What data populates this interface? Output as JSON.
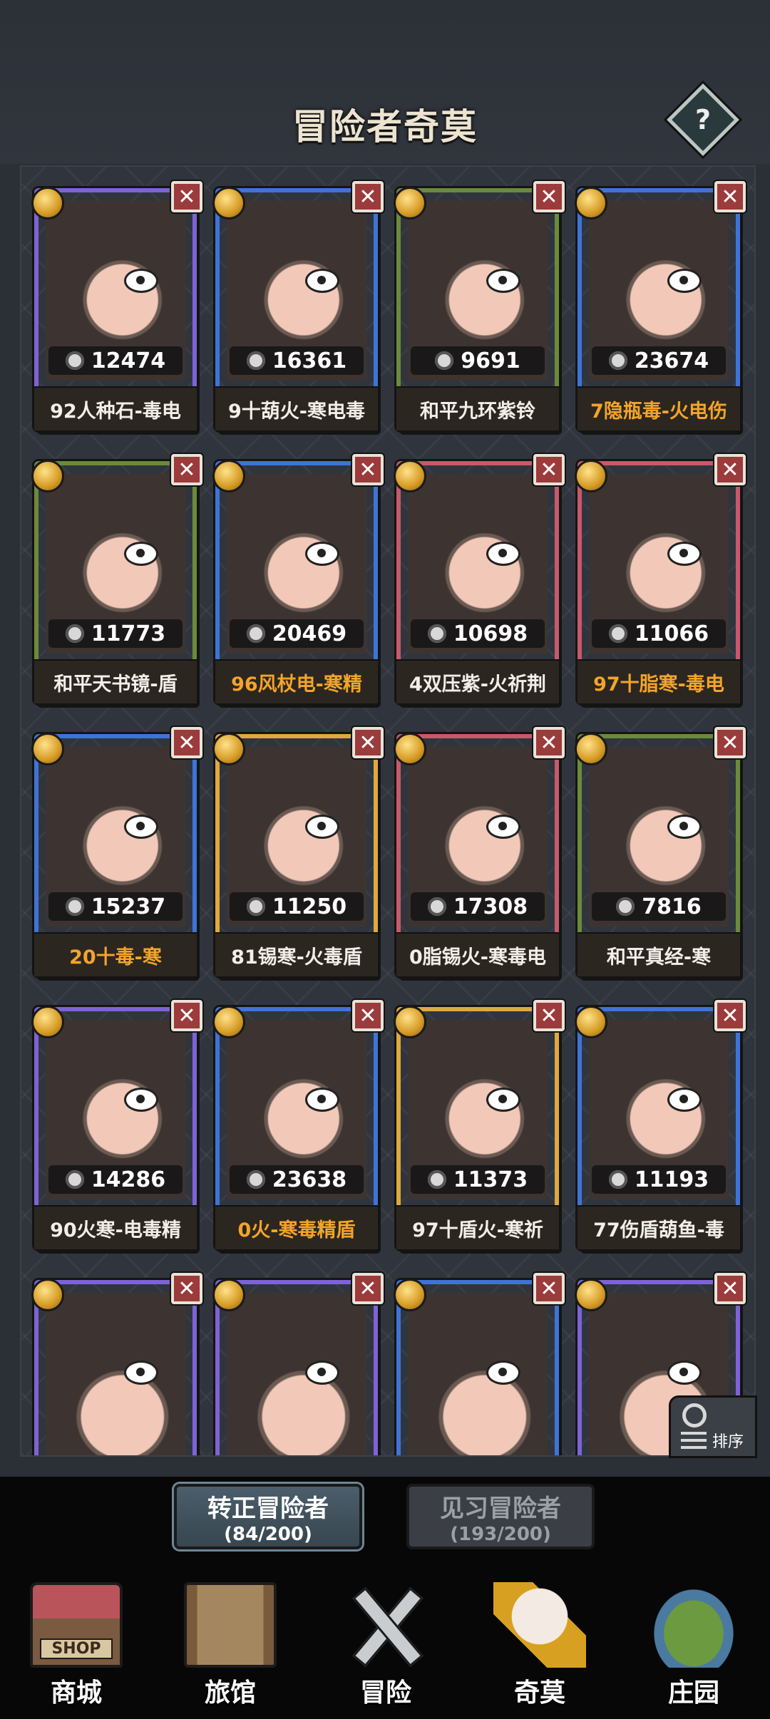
{
  "header": {
    "title": "冒险者奇莫",
    "help_label": "?"
  },
  "cards": [
    {
      "power": "12474",
      "name": "92人种石-毒电",
      "name_highlight": false,
      "frame": "purple"
    },
    {
      "power": "16361",
      "name": "9十葫火-寒电毒",
      "name_highlight": false,
      "frame": "blue"
    },
    {
      "power": "9691",
      "name": "和平九环紫铃",
      "name_highlight": false,
      "frame": "green"
    },
    {
      "power": "23674",
      "name": "7隐瓶毒-火电伤",
      "name_highlight": true,
      "frame": "blue"
    },
    {
      "power": "11773",
      "name": "和平天书镜-盾",
      "name_highlight": false,
      "frame": "green"
    },
    {
      "power": "20469",
      "name": "96风杖电-寒精",
      "name_highlight": true,
      "frame": "blue"
    },
    {
      "power": "10698",
      "name": "4双压紫-火祈荆",
      "name_highlight": false,
      "frame": "red"
    },
    {
      "power": "11066",
      "name": "97十脂寒-毒电",
      "name_highlight": true,
      "frame": "red"
    },
    {
      "power": "15237",
      "name": "20十毒-寒",
      "name_highlight": true,
      "frame": "blue"
    },
    {
      "power": "11250",
      "name": "81锡寒-火毒盾",
      "name_highlight": false,
      "frame": "orange"
    },
    {
      "power": "17308",
      "name": "0脂锡火-寒毒电",
      "name_highlight": false,
      "frame": "red"
    },
    {
      "power": "7816",
      "name": "和平真经-寒",
      "name_highlight": false,
      "frame": "green"
    },
    {
      "power": "14286",
      "name": "90火寒-电毒精",
      "name_highlight": false,
      "frame": "purple"
    },
    {
      "power": "23638",
      "name": "0火-寒毒精盾",
      "name_highlight": true,
      "frame": "blue"
    },
    {
      "power": "11373",
      "name": "97十盾火-寒祈",
      "name_highlight": false,
      "frame": "orange"
    },
    {
      "power": "11193",
      "name": "77伤盾葫鱼-毒",
      "name_highlight": false,
      "frame": "blue"
    },
    {
      "power": "",
      "name": "",
      "name_highlight": false,
      "frame": "purple"
    },
    {
      "power": "",
      "name": "",
      "name_highlight": false,
      "frame": "purple"
    },
    {
      "power": "",
      "name": "",
      "name_highlight": false,
      "frame": "blue"
    },
    {
      "power": "",
      "name": "",
      "name_highlight": false,
      "frame": "purple"
    }
  ],
  "close_label": "✕",
  "sort_button": {
    "label": "排序"
  },
  "tabs": [
    {
      "label": "转正冒险者",
      "count": "(84/200)",
      "active": true
    },
    {
      "label": "见习冒险者",
      "count": "(193/200)",
      "active": false
    }
  ],
  "nav": [
    {
      "label": "商城",
      "icon": "shop-icon",
      "badge": "SHOP"
    },
    {
      "label": "旅馆",
      "icon": "inn-icon"
    },
    {
      "label": "冒险",
      "icon": "adventure-icon"
    },
    {
      "label": "奇莫",
      "icon": "qimo-icon",
      "active": true
    },
    {
      "label": "庄园",
      "icon": "manor-icon"
    }
  ]
}
